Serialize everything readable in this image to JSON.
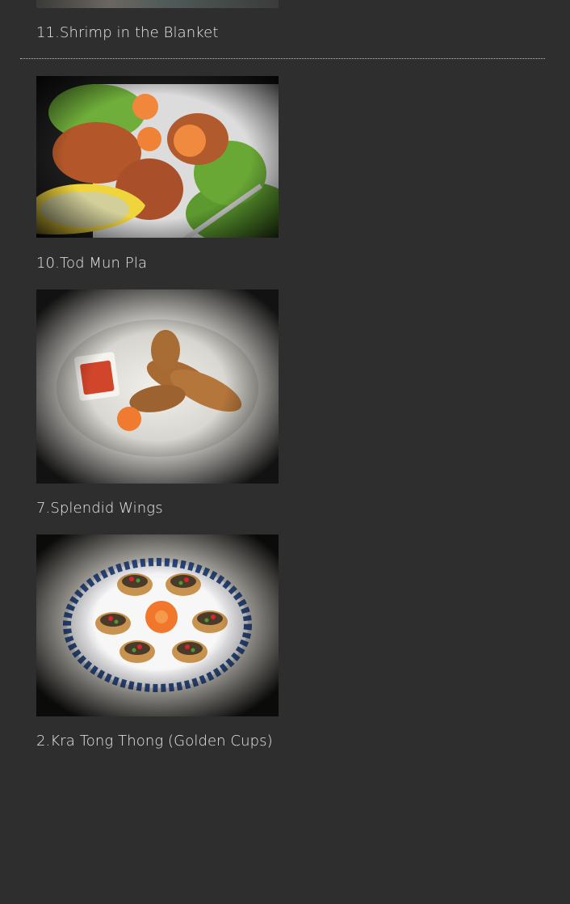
{
  "menu": {
    "items": [
      {
        "number": "11",
        "caption": "11.Shrimp in the Blanket",
        "image_alt": "Shrimp in the Blanket photo"
      },
      {
        "number": "10",
        "caption": "10.Tod Mun Pla",
        "image_alt": "Tod Mun Pla photo"
      },
      {
        "number": "7",
        "caption": "7.Splendid Wings",
        "image_alt": "Splendid Wings photo"
      },
      {
        "number": "2",
        "caption": "2.Kra Tong Thong (Golden Cups)",
        "image_alt": "Kra Tong Thong (Golden Cups) photo"
      }
    ]
  },
  "colors": {
    "background": "#2e2e2e",
    "caption_text": "#e9e9e9",
    "divider": "#bfbfbf"
  }
}
